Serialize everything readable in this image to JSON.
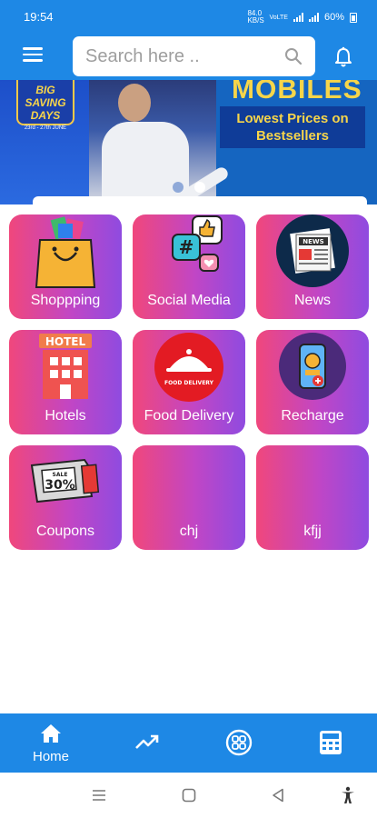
{
  "status_bar": {
    "time": "19:54",
    "network_speed": "84.0 KB/S",
    "network_type": "VoLTE",
    "battery": "60%"
  },
  "app_bar": {
    "search_placeholder": "Search here .."
  },
  "banner": {
    "badge_title": "BIG SAVING DAYS",
    "badge_dates": "23rd - 27th JUNE",
    "headline": "MOBILES",
    "promo": "Lowest Prices on Bestsellers",
    "slide_count": 2,
    "active_slide": 2
  },
  "grid": [
    {
      "label": "Shoppping",
      "icon": "shopping-bag-icon"
    },
    {
      "label": "Social Media",
      "icon": "social-media-icon"
    },
    {
      "label": "News",
      "icon": "newspaper-icon"
    },
    {
      "label": "Hotels",
      "icon": "hotel-icon"
    },
    {
      "label": "Food Delivery",
      "icon": "food-delivery-icon"
    },
    {
      "label": "Recharge",
      "icon": "mobile-recharge-icon"
    },
    {
      "label": "Coupons",
      "icon": "coupon-icon"
    },
    {
      "label": "chj",
      "icon": ""
    },
    {
      "label": "kfjj",
      "icon": ""
    }
  ],
  "bottom_nav": {
    "items": [
      {
        "label": "Home",
        "icon": "home-icon",
        "active": true
      },
      {
        "label": "",
        "icon": "trending-icon"
      },
      {
        "label": "",
        "icon": "apps-grid-icon"
      },
      {
        "label": "",
        "icon": "calculator-icon"
      }
    ]
  },
  "colors": {
    "primary": "#1e88e5",
    "card_gradient_start": "#f0477c",
    "card_gradient_end": "#8f4be0",
    "banner_yellow": "#f7d54a"
  }
}
